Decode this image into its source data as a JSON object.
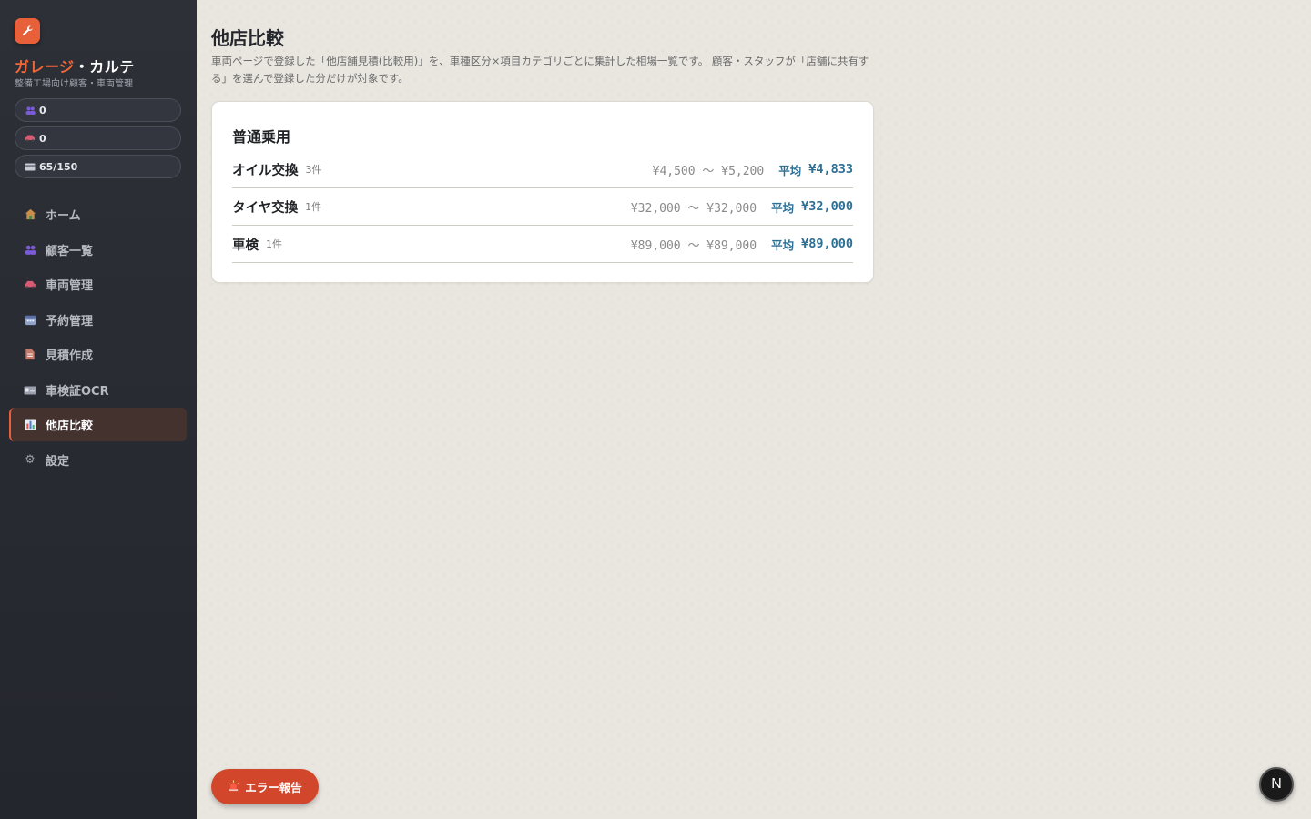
{
  "app": {
    "brand_primary": "ガレージ",
    "brand_separator": "・",
    "brand_secondary": "カルテ",
    "subtitle": "整備工場向け顧客・車両管理",
    "accent_color": "#e8603a",
    "logo_icon": "wrench-icon"
  },
  "stats": [
    {
      "icon": "people-icon",
      "value": "0"
    },
    {
      "icon": "car-icon",
      "value": "0"
    },
    {
      "icon": "card-icon",
      "value": "65/150"
    }
  ],
  "nav": [
    {
      "icon": "home-icon",
      "label": "ホーム"
    },
    {
      "icon": "people-icon",
      "label": "顧客一覧"
    },
    {
      "icon": "car-icon",
      "label": "車両管理"
    },
    {
      "icon": "calendar-icon",
      "label": "予約管理"
    },
    {
      "icon": "document-icon",
      "label": "見積作成"
    },
    {
      "icon": "id-card-icon",
      "label": "車検証OCR"
    },
    {
      "icon": "bar-chart-icon",
      "label": "他店比較",
      "active": true
    },
    {
      "icon": "gear-icon",
      "label": "設定"
    }
  ],
  "main": {
    "title": "他店比較",
    "description": "車両ページで登録した「他店舗見積(比較用)」を、車種区分×項目カテゴリごとに集計した相場一覧です。 顧客・スタッフが「店舗に共有する」を選んで登録した分だけが対象です。",
    "section": {
      "title": "普通乗用",
      "avg_label": "平均",
      "rows": [
        {
          "name": "オイル交換",
          "count": "3件",
          "range": "¥4,500 〜 ¥5,200",
          "avg": "¥4,833"
        },
        {
          "name": "タイヤ交換",
          "count": "1件",
          "range": "¥32,000 〜 ¥32,000",
          "avg": "¥32,000"
        },
        {
          "name": "車検",
          "count": "1件",
          "range": "¥89,000 〜 ¥89,000",
          "avg": "¥89,000"
        }
      ]
    }
  },
  "floating": {
    "error_button_label": "エラー報告",
    "error_button_icon": "siren-icon",
    "error_button_color": "#d2472c",
    "corner_badge_letter": "N"
  }
}
